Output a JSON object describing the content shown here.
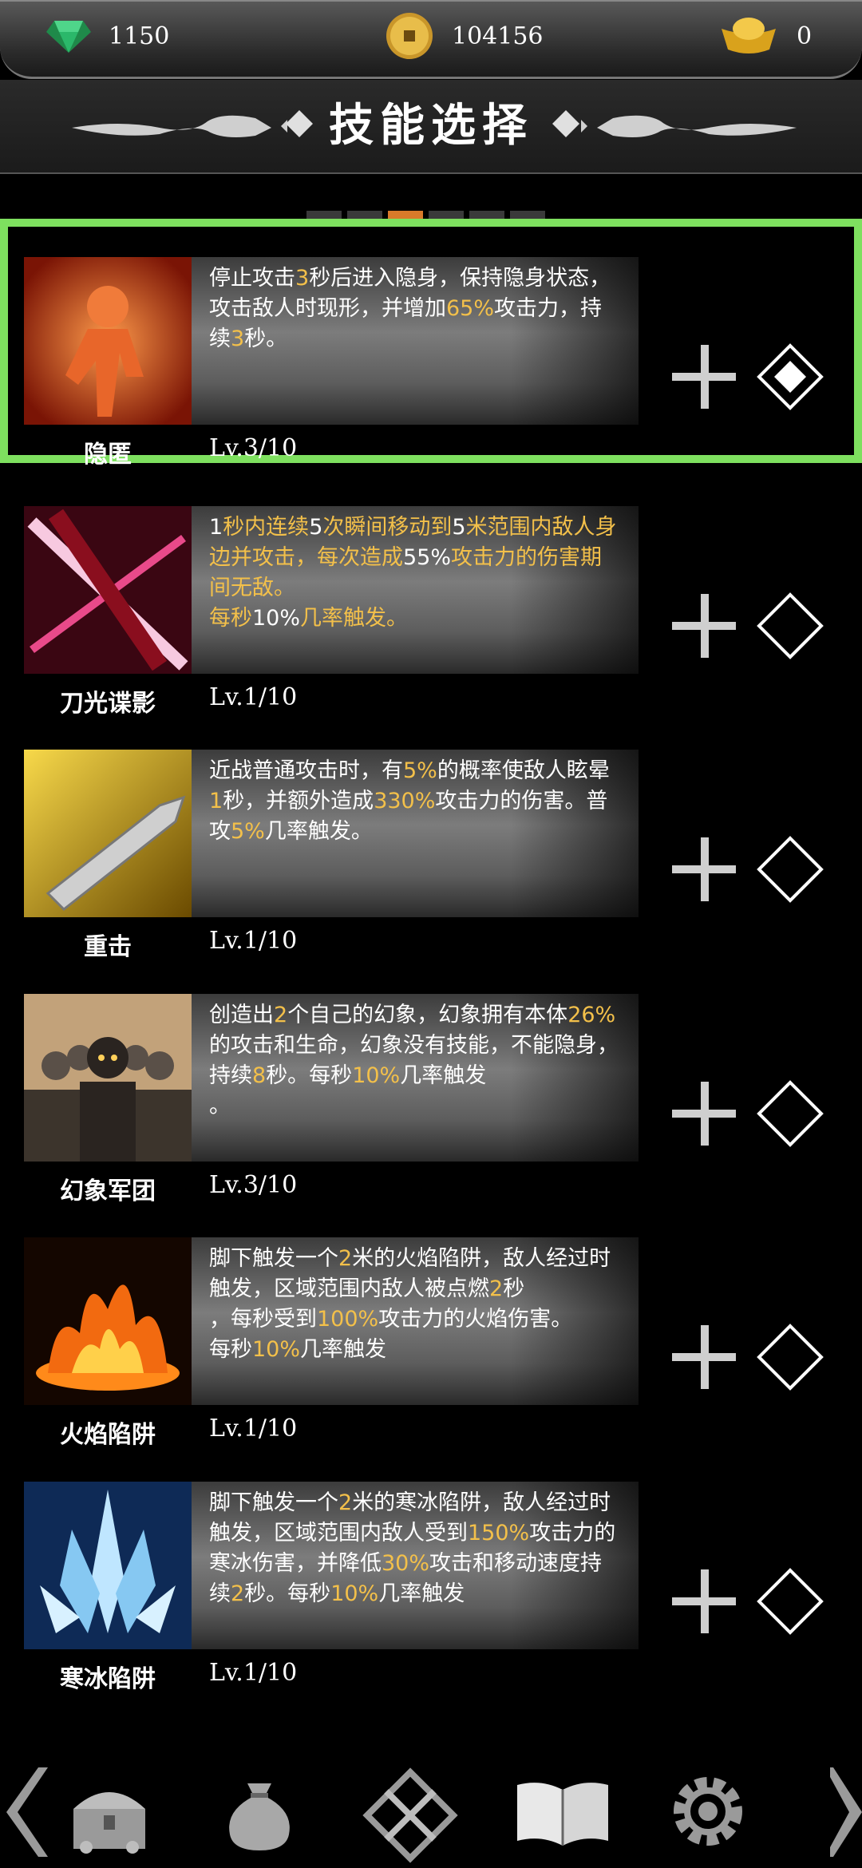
{
  "currency": {
    "gems": "1150",
    "coins": "104156",
    "ingots": "0"
  },
  "header": {
    "title": "技能选择"
  },
  "pager": {
    "count": 6,
    "active_index": 2
  },
  "colors": {
    "accent": "#f3c04a",
    "selected_outline": "#7ee05f",
    "pager_active": "#d97a2a"
  },
  "skills": [
    {
      "name": "隐匿",
      "level": "Lv.3/10",
      "selected": true,
      "desc": [
        "停止攻击",
        "3",
        "秒后进入隐身，保持隐身状态，攻击敌人时现形，并增加",
        "65%",
        "攻击力，持续",
        "3",
        "秒。"
      ],
      "icon": "stealth-figure-icon"
    },
    {
      "name": "刀光谍影",
      "level": "Lv.1/10",
      "selected": false,
      "desc": [
        "1",
        "秒内连续",
        "5",
        "次瞬间移动到",
        "5",
        "米范围内敌人身边并攻击，每次造成",
        "55%",
        "攻击力的伤害期间无敌。\n每秒",
        "10%",
        "几率触发。"
      ],
      "icon": "blade-slash-icon"
    },
    {
      "name": "重击",
      "level": "Lv.1/10",
      "selected": false,
      "desc": [
        "近战普通攻击时，有",
        "5%",
        "的概率使敌人眩晕",
        "1",
        "秒，并额外造成",
        "330%",
        "攻击力的伤害。普攻",
        "5%",
        "几率触发。"
      ],
      "icon": "heavy-strike-icon"
    },
    {
      "name": "幻象军团",
      "level": "Lv.3/10",
      "selected": false,
      "desc": [
        "创造出",
        "2",
        "个自己的幻象，幻象拥有本体",
        "26%",
        "的攻击和生命，幻象没有技能，不能隐身，持续",
        "8",
        "秒。每秒",
        "10%",
        "几率触发\n。"
      ],
      "icon": "phantom-army-icon"
    },
    {
      "name": "火焰陷阱",
      "level": "Lv.1/10",
      "selected": false,
      "desc": [
        "脚下触发一个",
        "2",
        "米的火焰陷阱，敌人经过时触发，区域范围内敌人被点燃",
        "2",
        "秒\n，每秒受到",
        "100%",
        "攻击力的火焰伤害。\n每秒",
        "10%",
        "几率触发"
      ],
      "icon": "fire-trap-icon"
    },
    {
      "name": "寒冰陷阱",
      "level": "Lv.1/10",
      "selected": false,
      "desc": [
        "脚下触发一个",
        "2",
        "米的寒冰陷阱，敌人经过时触发，区域范围内敌人受到",
        "150%",
        "攻击力的寒冰伤害，并降低",
        "30%",
        "攻击和移动速度持续",
        "2",
        "秒。每秒",
        "10%",
        "几率触发"
      ],
      "icon": "ice-trap-icon"
    }
  ],
  "nav": [
    {
      "icon": "treasure-chest-icon"
    },
    {
      "icon": "money-bag-icon"
    },
    {
      "icon": "crossed-swords-icon"
    },
    {
      "icon": "skill-book-icon",
      "active": true
    },
    {
      "icon": "settings-gear-icon"
    }
  ]
}
